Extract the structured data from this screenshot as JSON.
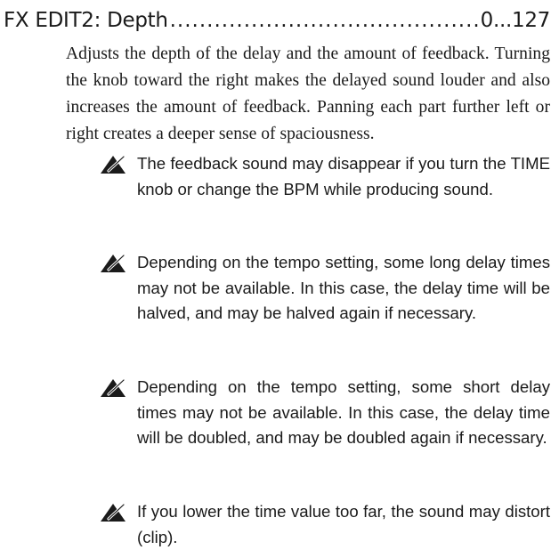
{
  "heading": {
    "label": "FX EDIT2: Depth",
    "leader": "............................................................................................",
    "range": "0...127"
  },
  "intro": "Adjusts the depth of the delay and the amount of feedback. Turning the knob toward the right makes the delayed sound louder and also increases the amount of feedback. Panning each part further left or right creates a deeper sense of spaciousness.",
  "notes": [
    {
      "icon": "note-icon",
      "text": "The feedback sound may disappear if you turn the TIME knob or change the BPM while producing sound."
    },
    {
      "icon": "note-icon",
      "text": "Depending on the tempo setting, some long delay times may not be available. In this case, the delay time will be halved, and may be halved again if necessary."
    },
    {
      "icon": "note-icon",
      "text": "Depending on the tempo setting, some short de­lay times may not be available. In this case, the delay time will be doubled, and may be doubled again if necessary."
    },
    {
      "icon": "note-icon",
      "text": "If you lower the time value too far, the sound may distort (clip)."
    }
  ]
}
